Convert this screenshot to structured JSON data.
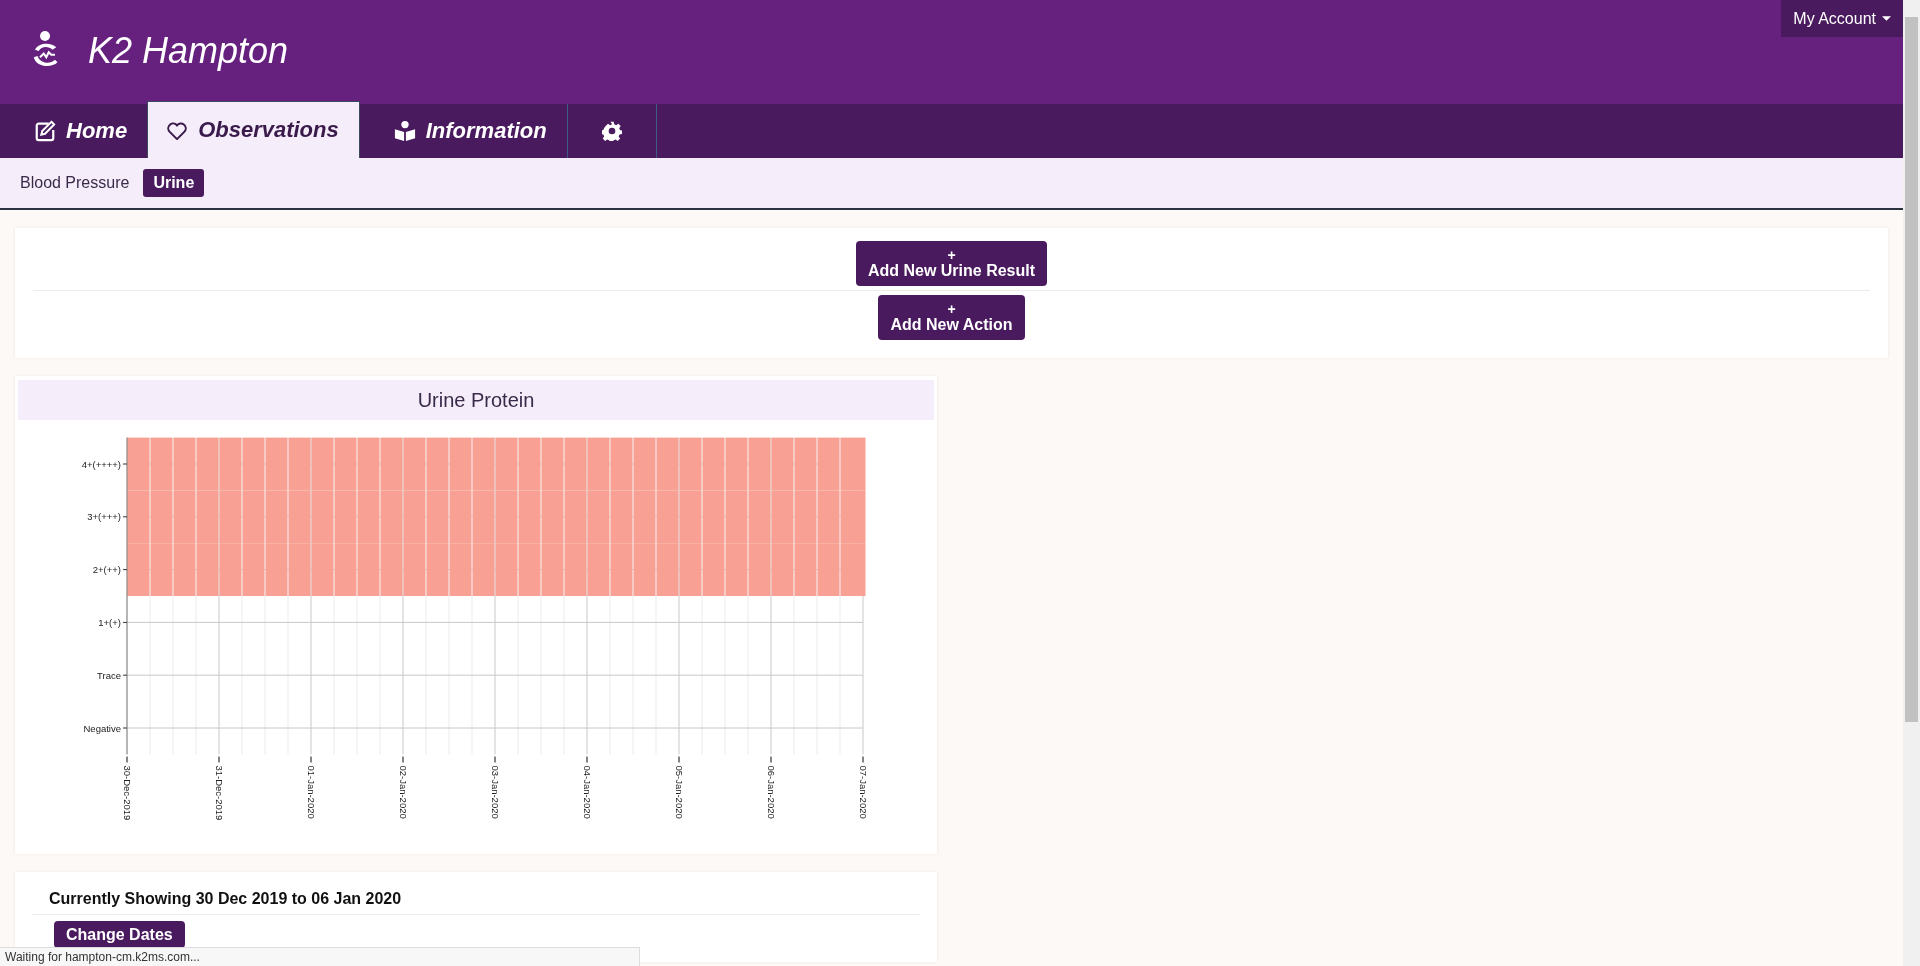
{
  "header": {
    "title": "K2 Hampton",
    "account_menu": "My Account"
  },
  "tabs": [
    {
      "kind": "text",
      "label": "Home",
      "selected": false
    },
    {
      "kind": "text",
      "label": "Observations",
      "selected": true
    },
    {
      "kind": "text",
      "label": "Information",
      "selected": false
    },
    {
      "kind": "settings",
      "selected": false
    }
  ],
  "subtabs": [
    {
      "label": "Blood Pressure",
      "selected": false
    },
    {
      "label": "Urine",
      "selected": true
    }
  ],
  "actions": [
    {
      "icon": "+",
      "label": "Add New Urine Result"
    },
    {
      "icon": "+",
      "label": "Add New Action"
    }
  ],
  "chart_panel": {
    "title": "Urine Protein",
    "y_levels": [
      {
        "label": "4+(++++)",
        "highlighted": true
      },
      {
        "label": "3+(+++)",
        "highlighted": true
      },
      {
        "label": "2+(++)",
        "highlighted": true
      },
      {
        "label": "1+(+)",
        "highlighted": false
      },
      {
        "label": "Trace",
        "highlighted": false
      },
      {
        "label": "Negative",
        "highlighted": false
      }
    ],
    "x_labels": [
      "30-Dec-2019",
      "31-Dec-2019",
      "01-Jan-2020",
      "02-Jan-2020",
      "03-Jan-2020",
      "04-Jan-2020",
      "05-Jan-2020",
      "06-Jan-2020",
      "07-Jan-2020"
    ]
  },
  "date_panel": {
    "summary": "Currently Showing 30 Dec 2019 to 06 Jan 2020",
    "button": "Change Dates"
  },
  "status_bar": "Waiting for hampton-cm.k2ms.com..."
}
